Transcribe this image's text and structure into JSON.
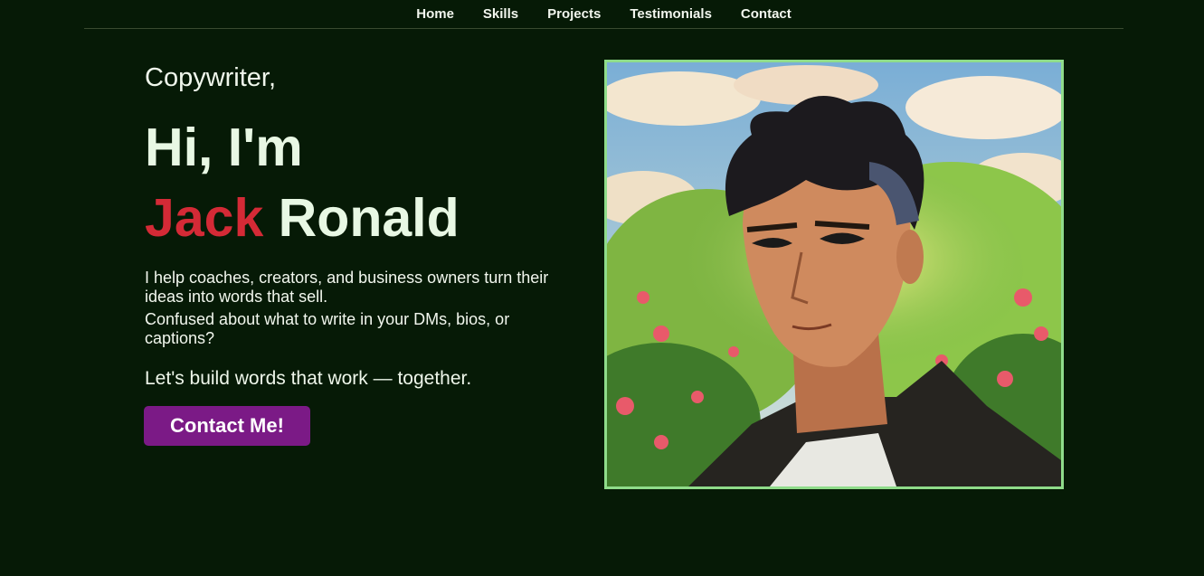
{
  "nav": {
    "items": [
      "Home",
      "Skills",
      "Projects",
      "Testimonials",
      "Contact"
    ]
  },
  "hero": {
    "role": "Copywriter,",
    "greeting": "Hi, I'm",
    "first_name": "Jack",
    "last_name": "Ronald",
    "description_1": "I help coaches, creators, and business owners turn their ideas into words that sell.",
    "description_2": "Confused about what to write in your DMs, bios, or captions?",
    "tagline": "Let's build words that work — together.",
    "button_label": "Contact Me!"
  },
  "colors": {
    "background": "#061a06",
    "accent_name": "#d42a36",
    "button": "#7b1a86",
    "portrait_border": "#8fdc8a"
  }
}
